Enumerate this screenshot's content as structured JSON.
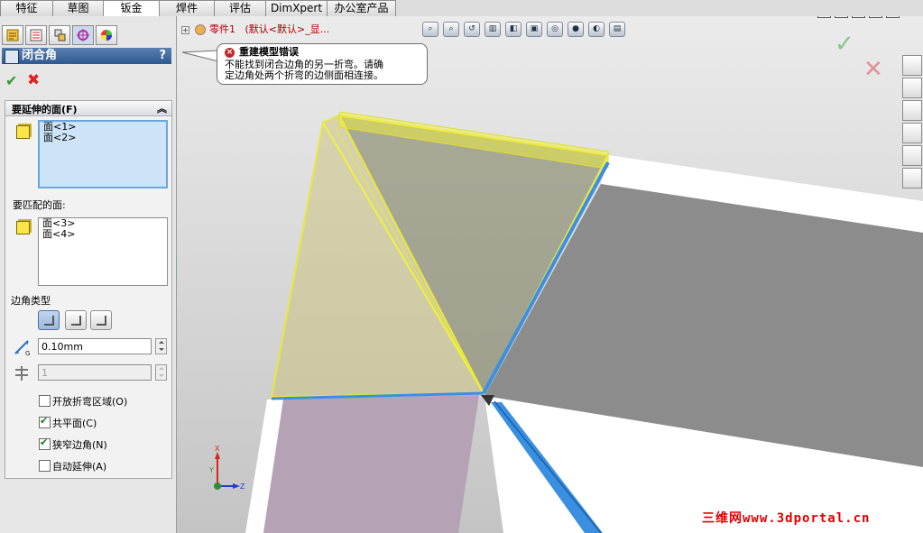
{
  "tabs": [
    "特征",
    "草图",
    "钣金",
    "焊件",
    "评估",
    "DimXpert",
    "办公室产品"
  ],
  "active_tab": "钣金",
  "property_manager": {
    "title": "闭合角",
    "help": "?",
    "faces_to_extend_label": "要延伸的面(F)",
    "faces_to_extend": [
      "面<1>",
      "面<2>"
    ],
    "faces_to_match_label": "要匹配的面:",
    "faces_to_match": [
      "面<3>",
      "面<4>"
    ],
    "corner_type_label": "边角类型",
    "gap_value": "0.10mm",
    "overlap_ratio": "1",
    "options": [
      {
        "label": "开放折弯区域(O)",
        "checked": false
      },
      {
        "label": "共平面(C)",
        "checked": true
      },
      {
        "label": "狭窄边角(N)",
        "checked": true
      },
      {
        "label": "自动延伸(A)",
        "checked": false
      }
    ]
  },
  "tree": {
    "part_name": "零件1",
    "config": "(默认<默认>_显..."
  },
  "error_tooltip": {
    "title": "重建模型错误",
    "line1": "不能找到闭合边角的另一折弯。请确",
    "line2": "定边角处两个折弯的边侧面相连接。"
  },
  "triad": {
    "x": "X",
    "y": "Y",
    "z": "Z"
  },
  "watermark": "三维网www.3dportal.cn",
  "colors": {
    "selection_yellow": "#f2f23a",
    "edge_blue": "#3a8fe0",
    "sheet_gray": "#8c8c8c",
    "face_purple": "#b5a3b5"
  }
}
